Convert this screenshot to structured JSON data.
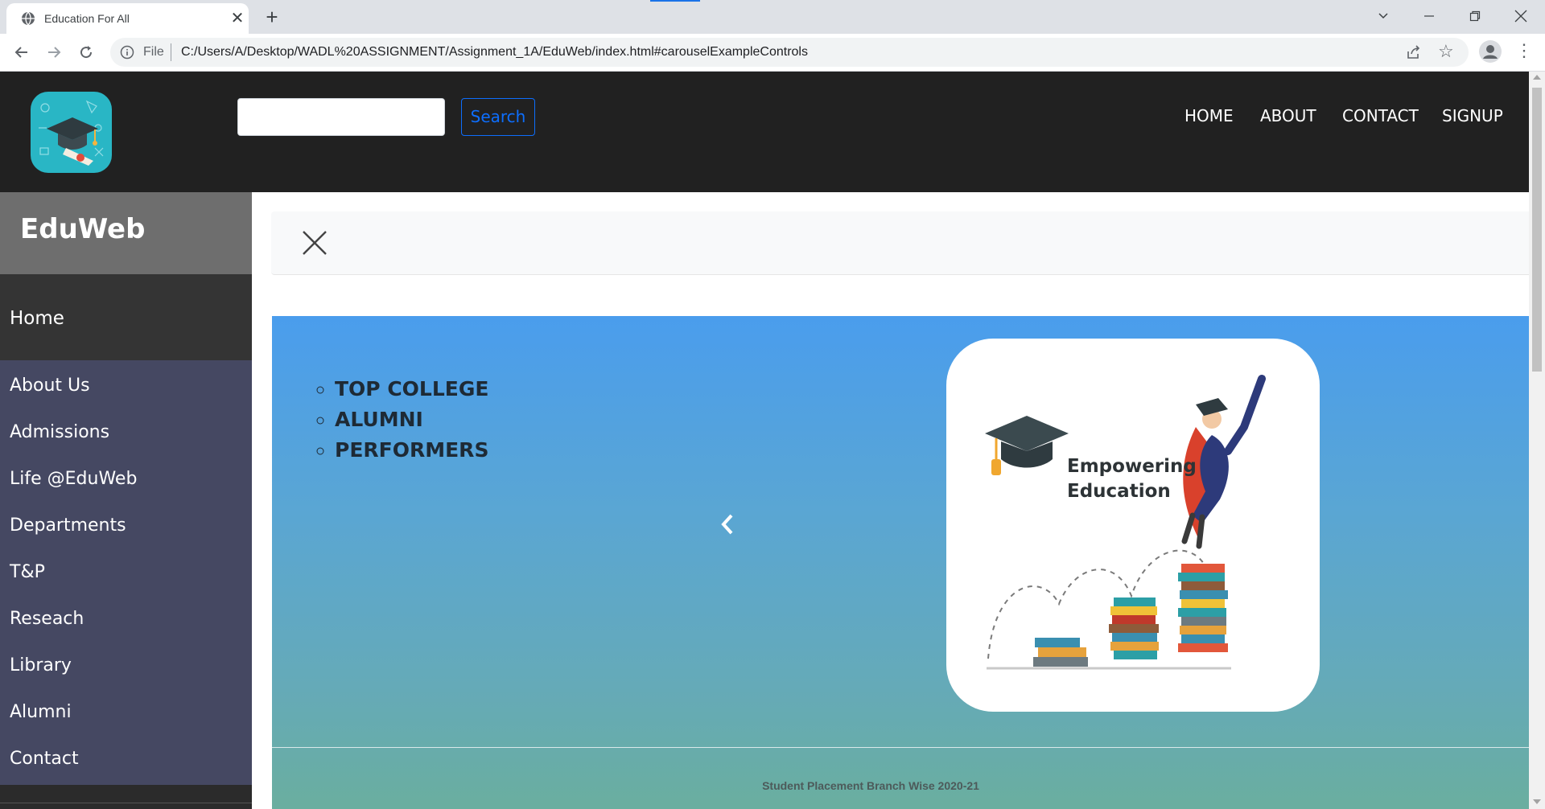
{
  "browser": {
    "tab_title": "Education For All",
    "tab_close": "✕",
    "new_tab": "+",
    "url_scheme": "File",
    "url": "C:/Users/A/Desktop/WADL%20ASSIGNMENT/Assignment_1A/EduWeb/index.html#carouselExampleControls",
    "window_controls": [
      "chevron-down-icon",
      "minimize-icon",
      "restore-icon",
      "close-icon"
    ]
  },
  "header": {
    "search_placeholder": "",
    "search_button": "Search",
    "nav": [
      "HOME",
      "ABOUT",
      "CONTACT",
      "SIGNUP"
    ]
  },
  "sidebar": {
    "brand": "EduWeb",
    "home": "Home",
    "items": [
      "About Us",
      "Admissions",
      "Life @EduWeb",
      "Departments",
      "T&P",
      "Reseach",
      "Library",
      "Alumni",
      "Contact"
    ]
  },
  "carousel": {
    "list": [
      "TOP COLLEGE",
      "ALUMNI",
      "PERFORMERS"
    ],
    "card_text_line1": "Empowering",
    "card_text_line2": "Education",
    "caption": "Student Placement Branch Wise 2020-21"
  },
  "colors": {
    "navbar_bg": "#212121",
    "sidebar_bg": "#454862",
    "brand_bg": "#6e6e6e",
    "accent": "#0d6efd",
    "carousel_top": "#4a9ded",
    "carousel_bottom": "#6aae9f"
  }
}
